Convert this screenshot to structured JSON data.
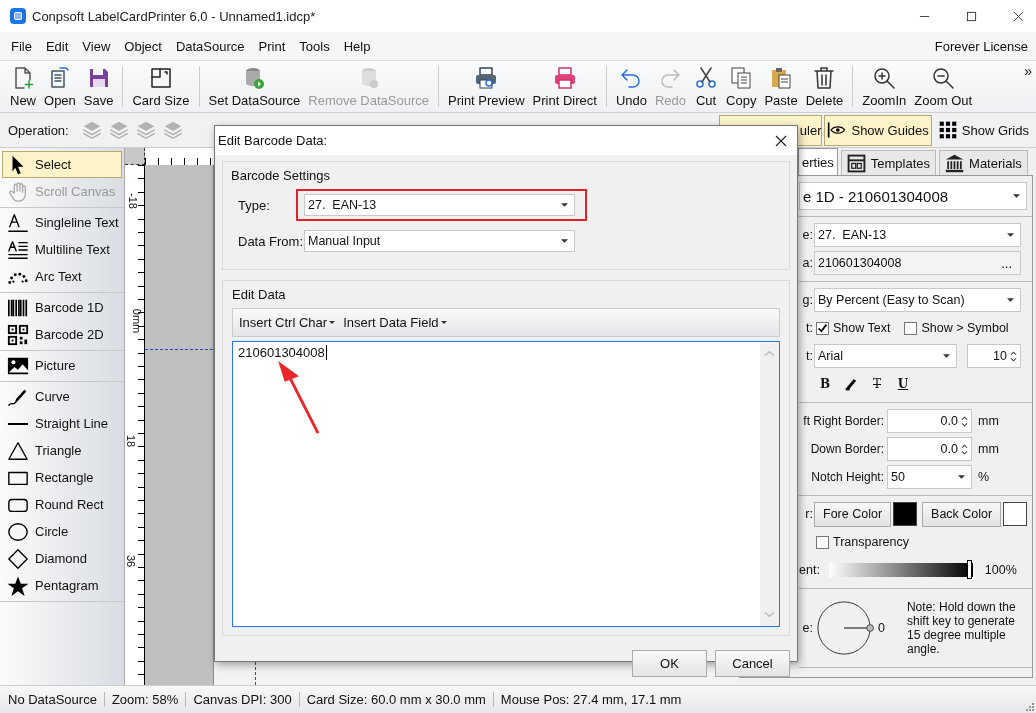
{
  "window": {
    "title": "Conpsoft LabelCardPrinter 6.0 - Unnamed1.idcp*"
  },
  "menu": [
    "File",
    "Edit",
    "View",
    "Object",
    "DataSource",
    "Print",
    "Tools",
    "Help"
  ],
  "license": "Forever License",
  "toolbar_groups": [
    [
      {
        "label": "New",
        "disabled": false
      },
      {
        "label": "Open",
        "disabled": false
      },
      {
        "label": "Save",
        "disabled": false
      }
    ],
    [
      {
        "label": "Card Size",
        "disabled": false
      }
    ],
    [
      {
        "label": "Set DataSource",
        "disabled": false
      },
      {
        "label": "Remove DataSource",
        "disabled": true
      }
    ],
    [
      {
        "label": "Print Preview",
        "disabled": false
      },
      {
        "label": "Print Direct",
        "disabled": false
      }
    ],
    [
      {
        "label": "Undo",
        "disabled": false
      },
      {
        "label": "Redo",
        "disabled": true
      },
      {
        "label": "Cut",
        "disabled": false
      },
      {
        "label": "Copy",
        "disabled": false
      },
      {
        "label": "Paste",
        "disabled": false
      },
      {
        "label": "Delete",
        "disabled": false
      }
    ],
    [
      {
        "label": "ZoomIn",
        "disabled": false
      },
      {
        "label": "Zoom Out",
        "disabled": false
      }
    ]
  ],
  "toolbar_more": "»",
  "operation": {
    "label": "Operation:",
    "buttons": [
      {
        "disabled": true
      },
      {
        "disabled": true
      },
      {
        "disabled": true
      },
      {
        "disabled": true
      }
    ]
  },
  "view_toggles": [
    {
      "label": "uler",
      "selected": true
    },
    {
      "label": "Show Guides",
      "selected": true
    },
    {
      "label": "Show Grids",
      "selected": false
    }
  ],
  "tool_groups": [
    [
      {
        "label": "Select",
        "selected": true,
        "disabled": false
      },
      {
        "label": "Scroll Canvas",
        "selected": false,
        "disabled": true
      }
    ],
    [
      {
        "label": "Singleline Text",
        "selected": false,
        "disabled": false
      },
      {
        "label": "Multiline Text",
        "selected": false,
        "disabled": false
      },
      {
        "label": "Arc Text",
        "selected": false,
        "disabled": false
      }
    ],
    [
      {
        "label": "Barcode 1D",
        "selected": false,
        "disabled": false
      },
      {
        "label": "Barcode 2D",
        "selected": false,
        "disabled": false
      }
    ],
    [
      {
        "label": "Picture",
        "selected": false,
        "disabled": false
      }
    ],
    [
      {
        "label": "Curve",
        "selected": false,
        "disabled": false
      },
      {
        "label": "Straight Line",
        "selected": false,
        "disabled": false
      },
      {
        "label": "Triangle",
        "selected": false,
        "disabled": false
      },
      {
        "label": "Rectangle",
        "selected": false,
        "disabled": false
      },
      {
        "label": "Round Rect",
        "selected": false,
        "disabled": false
      },
      {
        "label": "Circle",
        "selected": false,
        "disabled": false
      },
      {
        "label": "Diamond",
        "selected": false,
        "disabled": false
      },
      {
        "label": "Pentagram",
        "selected": false,
        "disabled": false
      }
    ]
  ],
  "ruler": {
    "marks": [
      "-18",
      "0mm",
      "18",
      "36"
    ]
  },
  "dialog": {
    "title": "Edit Barcode Data:",
    "settings": {
      "title": "Barcode Settings",
      "fields": [
        {
          "label": "Type:",
          "value": "27.  EAN-13",
          "highlighted": true
        },
        {
          "label": "Data From:",
          "value": "Manual Input",
          "highlighted": false
        }
      ]
    },
    "edit": {
      "title": "Edit Data",
      "menus": [
        "Insert Ctrl Char",
        "Insert Data Field"
      ],
      "value": "210601304008"
    },
    "buttons": [
      "OK",
      "Cancel"
    ]
  },
  "right_panel": {
    "tabs": [
      {
        "label": "erties",
        "selected": true
      },
      {
        "label": "Templates",
        "selected": false
      },
      {
        "label": "Materials",
        "selected": false
      }
    ],
    "object": "e 1D - 210601304008",
    "sections": [
      [
        {
          "kind": "select",
          "label": "e:",
          "value": "27.  EAN-13"
        },
        {
          "kind": "data",
          "label": "a:",
          "value": "210601304008",
          "button": "..."
        }
      ],
      [
        {
          "kind": "select",
          "label": "g:",
          "value": "By Percent (Easy to Scan)"
        },
        {
          "kind": "checks",
          "label": "t:",
          "checks": [
            {
              "label": "Show Text",
              "checked": true
            },
            {
              "label": "Show > Symbol",
              "checked": false
            }
          ]
        },
        {
          "kind": "font",
          "label": "t:",
          "value": "Arial",
          "size": "10"
        },
        {
          "kind": "styles",
          "styles": [
            {
              "kind": "bold",
              "label": "B"
            },
            {
              "kind": "italic"
            },
            {
              "kind": "strike",
              "label": "T"
            },
            {
              "kind": "underline",
              "label": "U"
            }
          ]
        }
      ],
      [
        {
          "kind": "spin",
          "label": "ft Right Border:",
          "value": "0.0",
          "unit": "mm"
        },
        {
          "kind": "spin",
          "label": "Down Border:",
          "value": "0.0",
          "unit": "mm"
        },
        {
          "kind": "combo",
          "label": "Notch Height:",
          "value": "50",
          "unit": "%"
        }
      ],
      [
        {
          "kind": "colors",
          "label": "r:",
          "colors": [
            {
              "label": "Fore Color",
              "color": "#000000"
            },
            {
              "label": "Back Color",
              "color": "#ffffff"
            }
          ]
        },
        {
          "kind": "checks",
          "checks": [
            {
              "label": "Transparency",
              "checked": false
            }
          ]
        },
        {
          "kind": "slider",
          "label": "ent:",
          "level": 1,
          "reading": "100%"
        }
      ],
      [
        {
          "kind": "angle",
          "label": "e:",
          "reading": "0",
          "note": "Note: Hold down the shift key to generate 15 degree multiple angle."
        }
      ]
    ]
  },
  "status_bar": [
    "No DataSource",
    "Zoom: 58%",
    "Canvas DPI: 300",
    "Card Size: 60.0 mm x 30.0 mm",
    "Mouse Pos: 27.4 mm, 17.1 mm"
  ]
}
